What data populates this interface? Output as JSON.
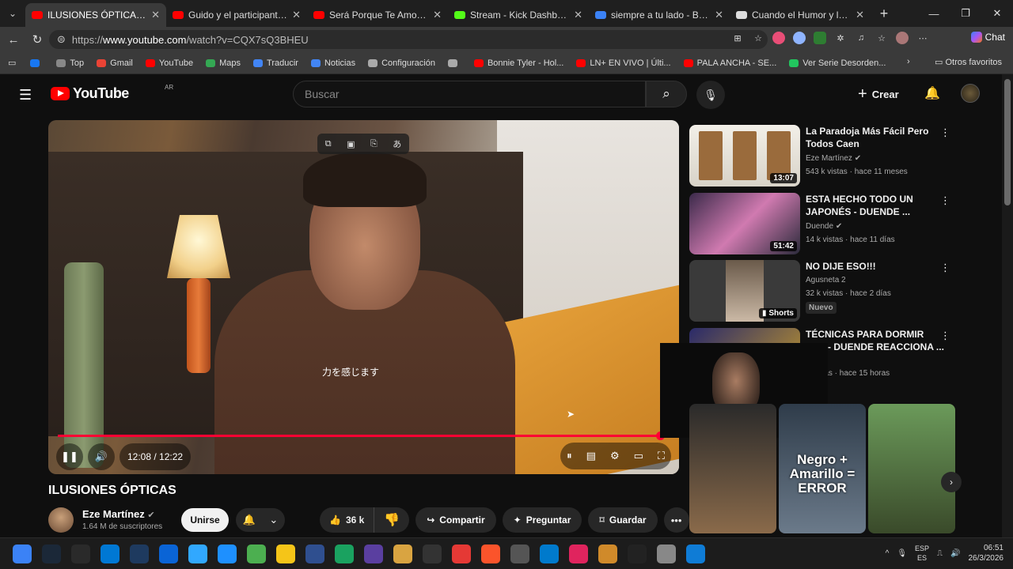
{
  "browser": {
    "tabs": [
      {
        "title": "ILUSIONES ÓPTICAS - YouTube",
        "color": "#ff0000",
        "active": true
      },
      {
        "title": "Guido y el participante que e...",
        "color": "#ff0000"
      },
      {
        "title": "Será Porque Te Amo - YouTube",
        "color": "#ff0000"
      },
      {
        "title": "Stream - Kick Dashboard",
        "color": "#53fc18"
      },
      {
        "title": "siempre a tu lado - Búsqueda",
        "color": "#3b82f6"
      },
      {
        "title": "Cuando el Humor y las Mate...",
        "color": "#dddddd"
      }
    ],
    "url_prefix": "https://",
    "url_host": "www.youtube.com",
    "url_path": "/watch?v=CQX7sQ3BHEU",
    "chat_label": "Chat",
    "bookmarks": [
      {
        "label": "",
        "color": "#1877f2"
      },
      {
        "label": "Top",
        "color": "#888888"
      },
      {
        "label": "Gmail",
        "color": "#ea4335"
      },
      {
        "label": "YouTube",
        "color": "#ff0000"
      },
      {
        "label": "Maps",
        "color": "#34a853"
      },
      {
        "label": "Traducir",
        "color": "#4285f4"
      },
      {
        "label": "Noticias",
        "color": "#4285f4"
      },
      {
        "label": "Configuración",
        "color": "#aaaaaa"
      },
      {
        "label": "",
        "color": "#aaaaaa"
      },
      {
        "label": "Bonnie Tyler - Hol...",
        "color": "#ff0000"
      },
      {
        "label": "LN+ EN VIVO | Últi...",
        "color": "#ff0000"
      },
      {
        "label": "PALA ANCHA - SE...",
        "color": "#ff0000"
      },
      {
        "label": "Ver Serie Desorden...",
        "color": "#22c55e"
      }
    ],
    "other_favs": "Otros favoritos"
  },
  "youtube": {
    "logo_text": "YouTube",
    "country": "AR",
    "search_placeholder": "Buscar",
    "create_label": "Crear"
  },
  "player": {
    "time_current": "12:08",
    "time_total": "12:22",
    "progress": 0.984,
    "shirt_text": "力を感じます"
  },
  "video": {
    "title": "ILUSIONES ÓPTICAS",
    "channel": "Eze Martínez",
    "subscribers": "1.64 M de suscriptores",
    "join_label": "Unirse",
    "likes": "36 k",
    "share_label": "Compartir",
    "ask_label": "Preguntar",
    "save_label": "Guardar"
  },
  "recommendations": [
    {
      "title": "La Paradoja Más Fácil Pero Todos Caen",
      "channel": "Eze Martínez",
      "meta": "543 k vistas · hace 11 meses",
      "duration": "13:07",
      "verified": true
    },
    {
      "title": "ESTA HECHO TODO UN JAPONÉS - DUENDE ...",
      "channel": "Duende",
      "meta": "14 k vistas · hace 11 días",
      "duration": "51:42",
      "verified": true
    },
    {
      "title": "NO DIJE ESO!!!",
      "channel": "Agusneta 2",
      "meta": "32 k vistas · hace 2 días",
      "duration": "Shorts",
      "badge": "Nuevo"
    },
    {
      "title": "TÉCNICAS PARA DORMIR ...OR- DUENDE REACCIONA ...",
      "channel": "",
      "meta": "...vistas · hace 15 horas",
      "duration": ""
    }
  ],
  "shorts": [
    {
      "text": ""
    },
    {
      "text": "Negro + Amarillo = ERROR"
    },
    {
      "text": ""
    }
  ],
  "taskbar": {
    "lang_top": "ESP",
    "lang_bottom": "ES",
    "time": "06:51",
    "date": "26/3/2026"
  }
}
